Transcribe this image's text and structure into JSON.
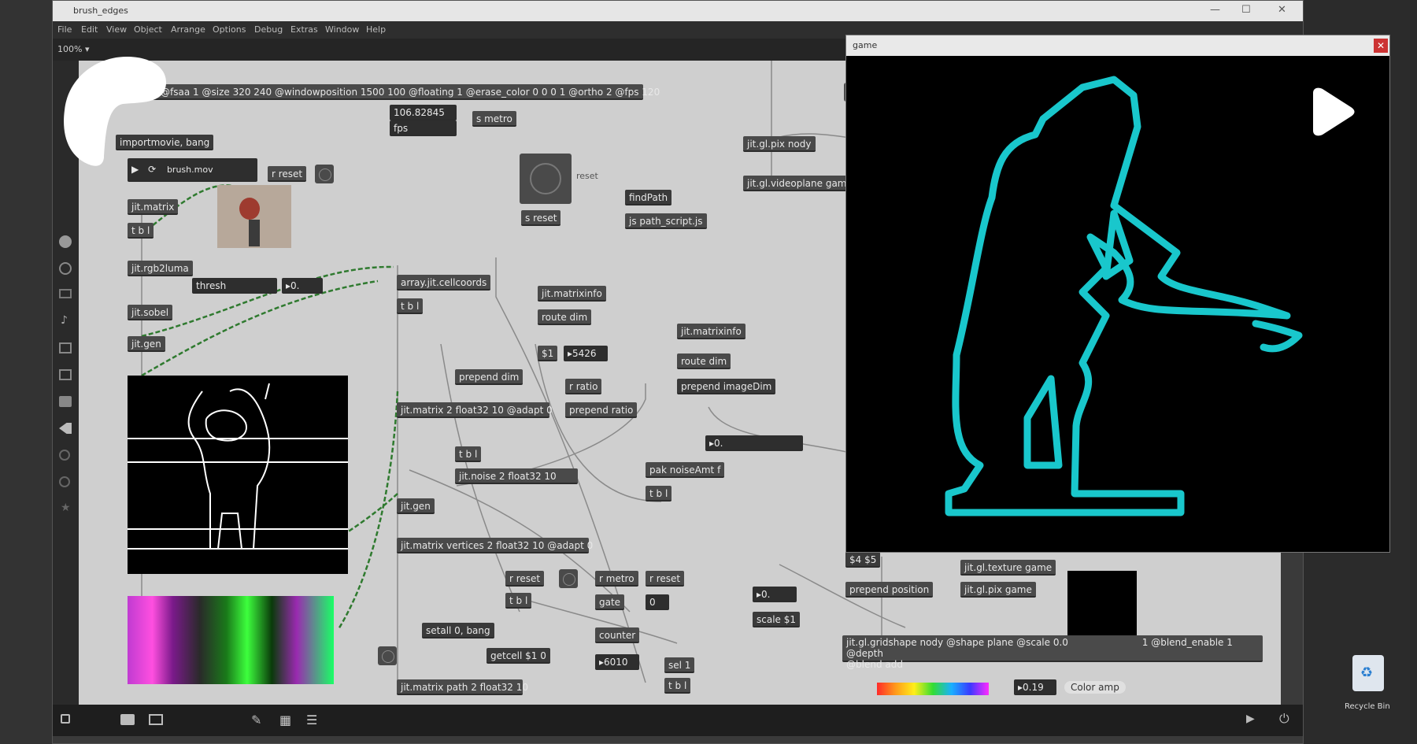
{
  "desktop": {
    "recycle_bin_label": "Recycle Bin"
  },
  "window": {
    "title": "brush_edges",
    "controls": {
      "minimize": "—",
      "maximize": "☐",
      "close": "✕"
    }
  },
  "menu": [
    "File",
    "Edit",
    "View",
    "Object",
    "Arrange",
    "Options",
    "Debug",
    "Extras",
    "Window",
    "Help"
  ],
  "toolbar": {
    "zoom": "100% ▾"
  },
  "patch": {
    "world_obj": "jit.world @fsaa 1 @size 320 240 @windowposition 1500 100 @floating 1 @erase_color 0 0 0 1 @ortho 2 @fps 120",
    "fps_value": "106.82845",
    "fps_label": "fps",
    "s_metro": "s metro",
    "importmovie": "importmovie, bang",
    "movie_file": "brush.mov",
    "r_reset": "r reset",
    "reset_label": "reset",
    "s_reset": "s reset",
    "findpath": "findPath",
    "js_path_script": "js path_script.js",
    "jit_matrix": "jit.matrix",
    "t_b_1": "t b l",
    "jit_rgb2luma": "jit.rgb2luma",
    "thresh_label": "thresh",
    "thresh_num": "▸0.",
    "jit_sobel": "jit.sobel",
    "jit_gen": "jit.gen",
    "array_cellcoords": "array.jit.cellcoords",
    "t_b_l2": "t b l",
    "jit_matrixinfo": "jit.matrixinfo",
    "route_dim": "route dim",
    "dollar1": "$1",
    "num_5426": "▸5426",
    "jit_matrixinfo2": "jit.matrixinfo",
    "route_dim2": "route dim",
    "prepend_imagedim": "prepend imageDim",
    "prepend_dim": "prepend dim",
    "r_ratio": "r ratio",
    "prepend_ratio": "prepend ratio",
    "jit_matrix2": "jit.matrix 2 float32 10 @adapt 0",
    "t_b_l3": "t b l",
    "jit_noise": "jit.noise 2 float32 10",
    "num_0": "▸0.",
    "pak_noiseamt": "pak noiseAmt f",
    "t_b_l4": "t b l",
    "jit_gen2": "jit.gen",
    "jit_matrix_vertices": "jit.matrix vertices 2 float32 10 @adapt 0",
    "r_reset2": "r reset",
    "t_b_l5": "t b l",
    "r_metro": "r metro",
    "r_reset3": "r reset",
    "gate": "gate",
    "zero": "0",
    "setall": "setall 0, bang",
    "getcell": "getcell $1 0",
    "counter": "counter",
    "num_6010": "▸6010",
    "sel_1": "sel 1",
    "t_b_l6": "t b l",
    "jit_matrix_path": "jit.matrix path 2 float32 10",
    "num_0b": "▸0.",
    "scale_dollar1": "scale $1",
    "pos_44": "$4 $5",
    "prepend_position": "prepend position",
    "jit_gl_texture": "jit.gl.texture game",
    "jit_gl_pix": "jit.gl.pix game",
    "gridshape": "jit.gl.gridshape nody @shape plane @scale 0.0",
    "gridshape_tail": "1 @blend_enable 1 @depth",
    "blend_add": "@blend add",
    "num_019": "▸0.19",
    "color_amp": "Color amp",
    "jit_gl_pix_nody": "jit.gl.pix nody",
    "jit_gl_videoplane": "jit.gl.videoplane game @tra"
  },
  "game_window": {
    "title": "game",
    "close": "✕"
  },
  "colors": {
    "canvas": "#cfcfcf",
    "outline": "#19c7cc",
    "patchcord": "#3a8a3a"
  },
  "icons": [
    "play-overlay-icon",
    "logo-icon",
    "recycle-bin-icon"
  ]
}
